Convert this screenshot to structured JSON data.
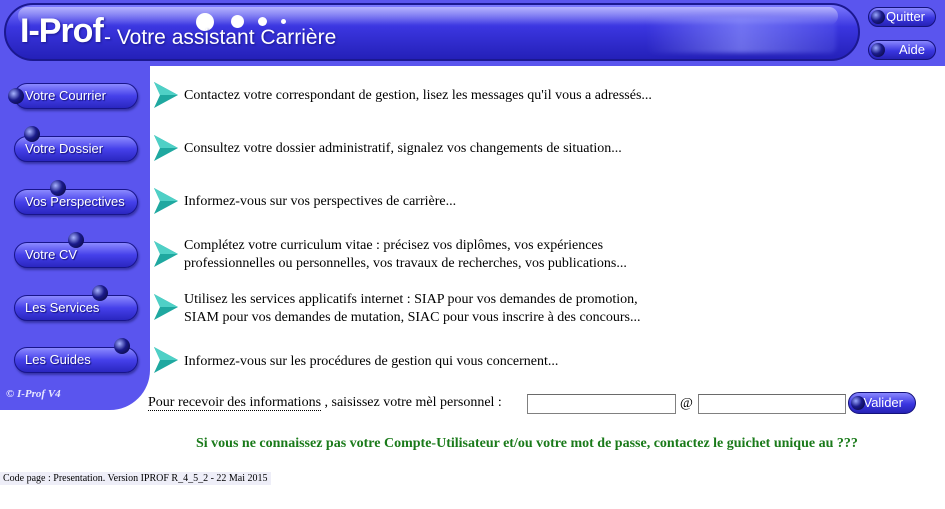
{
  "header": {
    "logo": "I-Prof",
    "subtitle": "- Votre assistant Carrière",
    "quit_label": "Quitter",
    "help_label": "Aide"
  },
  "sidebar": {
    "items": [
      {
        "label": "Votre Courrier"
      },
      {
        "label": "Votre Dossier"
      },
      {
        "label": "Vos Perspectives"
      },
      {
        "label": "Votre CV"
      },
      {
        "label": "Les Services"
      },
      {
        "label": "Les Guides"
      }
    ],
    "version": "© I-Prof  V4"
  },
  "main": {
    "rows": [
      {
        "lines": [
          "Contactez votre correspondant de gestion, lisez les messages qu'il vous a adressés..."
        ]
      },
      {
        "lines": [
          "Consultez votre dossier administratif, signalez vos changements de situation..."
        ]
      },
      {
        "lines": [
          "Informez-vous sur vos perspectives de carrière..."
        ]
      },
      {
        "lines": [
          "Complétez votre curriculum vitae : précisez vos diplômes, vos expériences",
          "professionnelles ou personnelles, vos travaux de recherches, vos publications..."
        ]
      },
      {
        "lines": [
          "Utilisez les services applicatifs internet : SIAP pour vos demandes de promotion,",
          "SIAM pour vos demandes de mutation, SIAC pour vous inscrire à des concours..."
        ]
      },
      {
        "lines": [
          "Informez-vous sur les procédures de gestion qui vous concernent..."
        ]
      }
    ]
  },
  "email_form": {
    "label_link": "Pour recevoir des informations",
    "label_rest": " , saisissez votre mèl personnel :",
    "user_value": "",
    "at": "@",
    "domain_value": "",
    "submit_label": "Valider"
  },
  "help_text": "Si vous ne connaissez pas votre Compte-Utilisateur et/ou votre mot de passe, contactez le guichet unique au ???",
  "footer": "Code page : Presentation. Version IPROF R_4_5_2 - 22 Mai 2015",
  "colors": {
    "brand_blue": "#5a55ee",
    "help_green": "#1a7a1a",
    "arrow_teal": "#1fa8a0"
  }
}
